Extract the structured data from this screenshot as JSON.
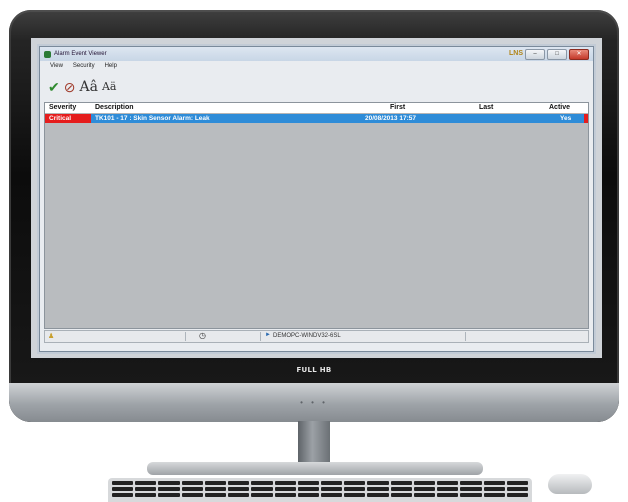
{
  "window": {
    "title": "Alarm Event Viewer",
    "logo_text": "LNS",
    "controls": {
      "minimize": "–",
      "maximize": "□",
      "close": "✕"
    }
  },
  "menu": {
    "items": [
      "View",
      "Security",
      "Help"
    ]
  },
  "toolbar": {
    "icons": [
      "acknowledge-icon",
      "clear-icon"
    ],
    "font_increase_label": "Aâ",
    "font_decrease_label": "Aä"
  },
  "grid": {
    "columns": [
      "Severity",
      "Description",
      "First",
      "Last",
      "Active"
    ],
    "rows": [
      {
        "severity": "Critical",
        "description": "TK101 - 17 : Skin Sensor Alarm: Leak",
        "first": "20/08/2013 17:57",
        "last": "",
        "active": "Yes"
      }
    ],
    "colors": {
      "critical": "#e51d1d",
      "selected_row": "#2e8cd8",
      "empty_area": "#b9bcbf"
    }
  },
  "statusbar": {
    "server": "DEMOPC-WINDV32-6SL"
  },
  "monitor": {
    "brand_label": "FULL HB",
    "power_leds": "• • •"
  }
}
